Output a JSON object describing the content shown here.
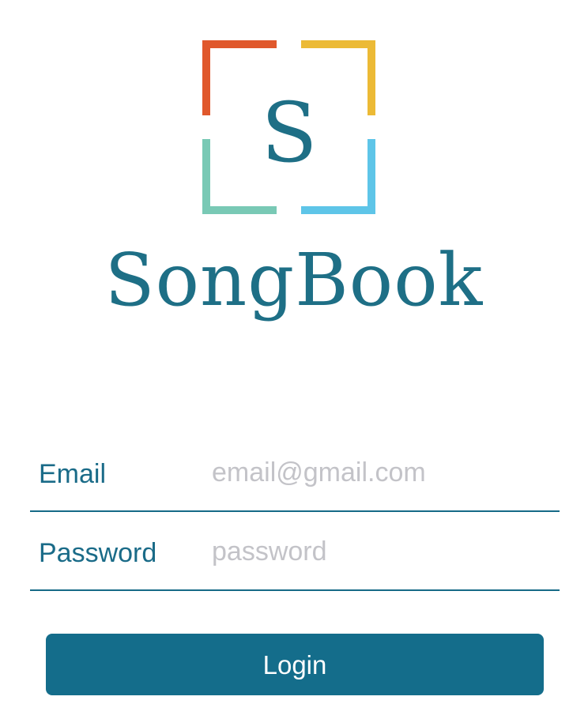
{
  "logo": {
    "monogram": "S",
    "wordmark": "SongBook",
    "colors": {
      "top_left": "#e0582c",
      "top_right": "#ecba36",
      "bottom_left": "#79c9b5",
      "bottom_right": "#5ec5e8",
      "text": "#1e6f86"
    }
  },
  "form": {
    "email": {
      "label": "Email",
      "value": "",
      "placeholder": "email@gmail.com"
    },
    "password": {
      "label": "Password",
      "value": "",
      "placeholder": "password"
    }
  },
  "login_button": {
    "label": "Login",
    "color": "#146d8b"
  }
}
